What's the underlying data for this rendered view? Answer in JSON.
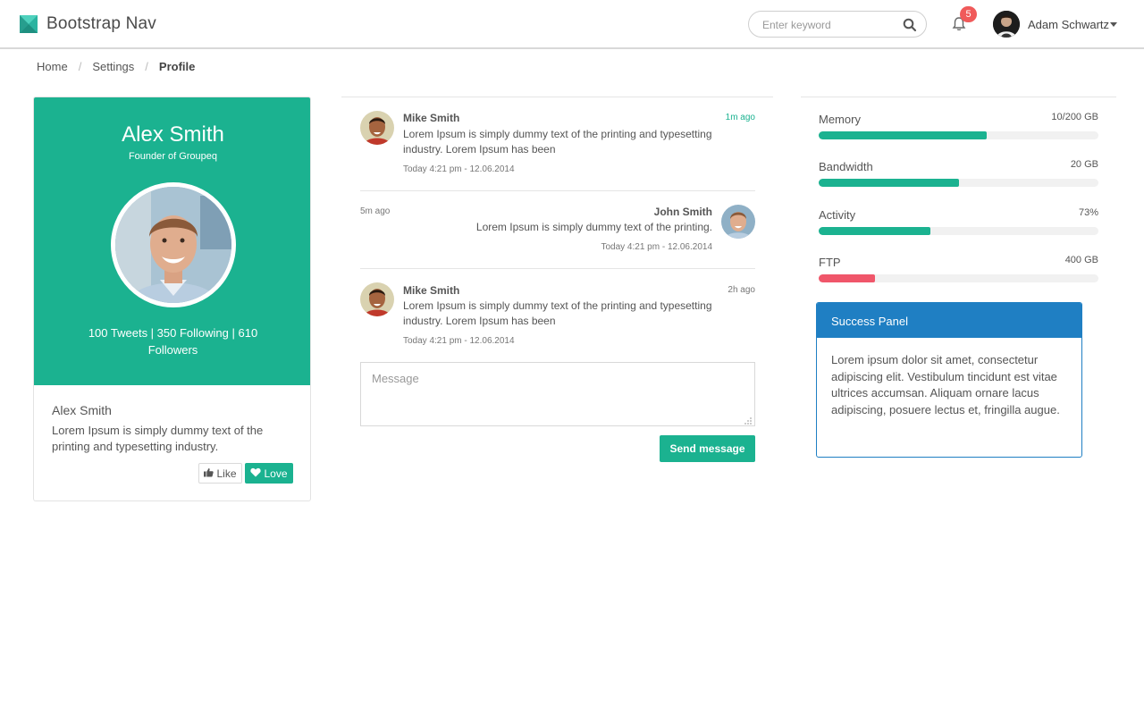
{
  "navbar": {
    "brand": "Bootstrap Nav",
    "search_placeholder": "Enter keyword",
    "notification_count": "5",
    "user_name": "Adam Schwartz"
  },
  "breadcrumb": {
    "items": [
      "Home",
      "Settings"
    ],
    "active": "Profile",
    "separator": "/"
  },
  "profile": {
    "name": "Alex Smith",
    "role": "Founder of Groupeq",
    "stats": "100 Tweets | 350 Following | 610 Followers",
    "bottom_name": "Alex Smith",
    "bio": "Lorem Ipsum is simply dummy text of the printing and typesetting industry.",
    "like_label": "Like",
    "love_label": "Love"
  },
  "chat": {
    "messages": [
      {
        "name": "Mike Smith",
        "time": "1m ago",
        "text": "Lorem Ipsum is simply dummy text of the printing and typesetting industry. Lorem Ipsum has been",
        "date": "Today 4:21 pm - 12.06.2014"
      },
      {
        "name": "John Smith",
        "time": "5m ago",
        "text": "Lorem Ipsum is simply dummy text of the printing.",
        "date": "Today 4:21 pm - 12.06.2014"
      },
      {
        "name": "Mike Smith",
        "time": "2h ago",
        "text": "Lorem Ipsum is simply dummy text of the printing and typesetting industry. Lorem Ipsum has been",
        "date": "Today 4:21 pm - 12.06.2014"
      }
    ],
    "message_placeholder": "Message",
    "send_label": "Send message"
  },
  "stats": [
    {
      "label": "Memory",
      "value": "10/200 GB",
      "fraction": 0.6,
      "color": "#1bb290"
    },
    {
      "label": "Bandwidth",
      "value": "20 GB",
      "fraction": 0.5,
      "color": "#1bb290"
    },
    {
      "label": "Activity",
      "value": "73%",
      "fraction": 0.4,
      "color": "#1bb290"
    },
    {
      "label": "FTP",
      "value": "400 GB",
      "fraction": 0.2,
      "color": "#f0566a"
    }
  ],
  "success_panel": {
    "title": "Success Panel",
    "body": "Lorem ipsum dolor sit amet, consectetur adipiscing elit. Vestibulum tincidunt est vitae ultrices accumsan. Aliquam ornare lacus adipiscing, posuere lectus et, fringilla augue."
  },
  "colors": {
    "accent": "#1bb290",
    "panel_blue": "#1f7fc3",
    "danger": "#f0566a",
    "badge": "#f05a5a"
  }
}
